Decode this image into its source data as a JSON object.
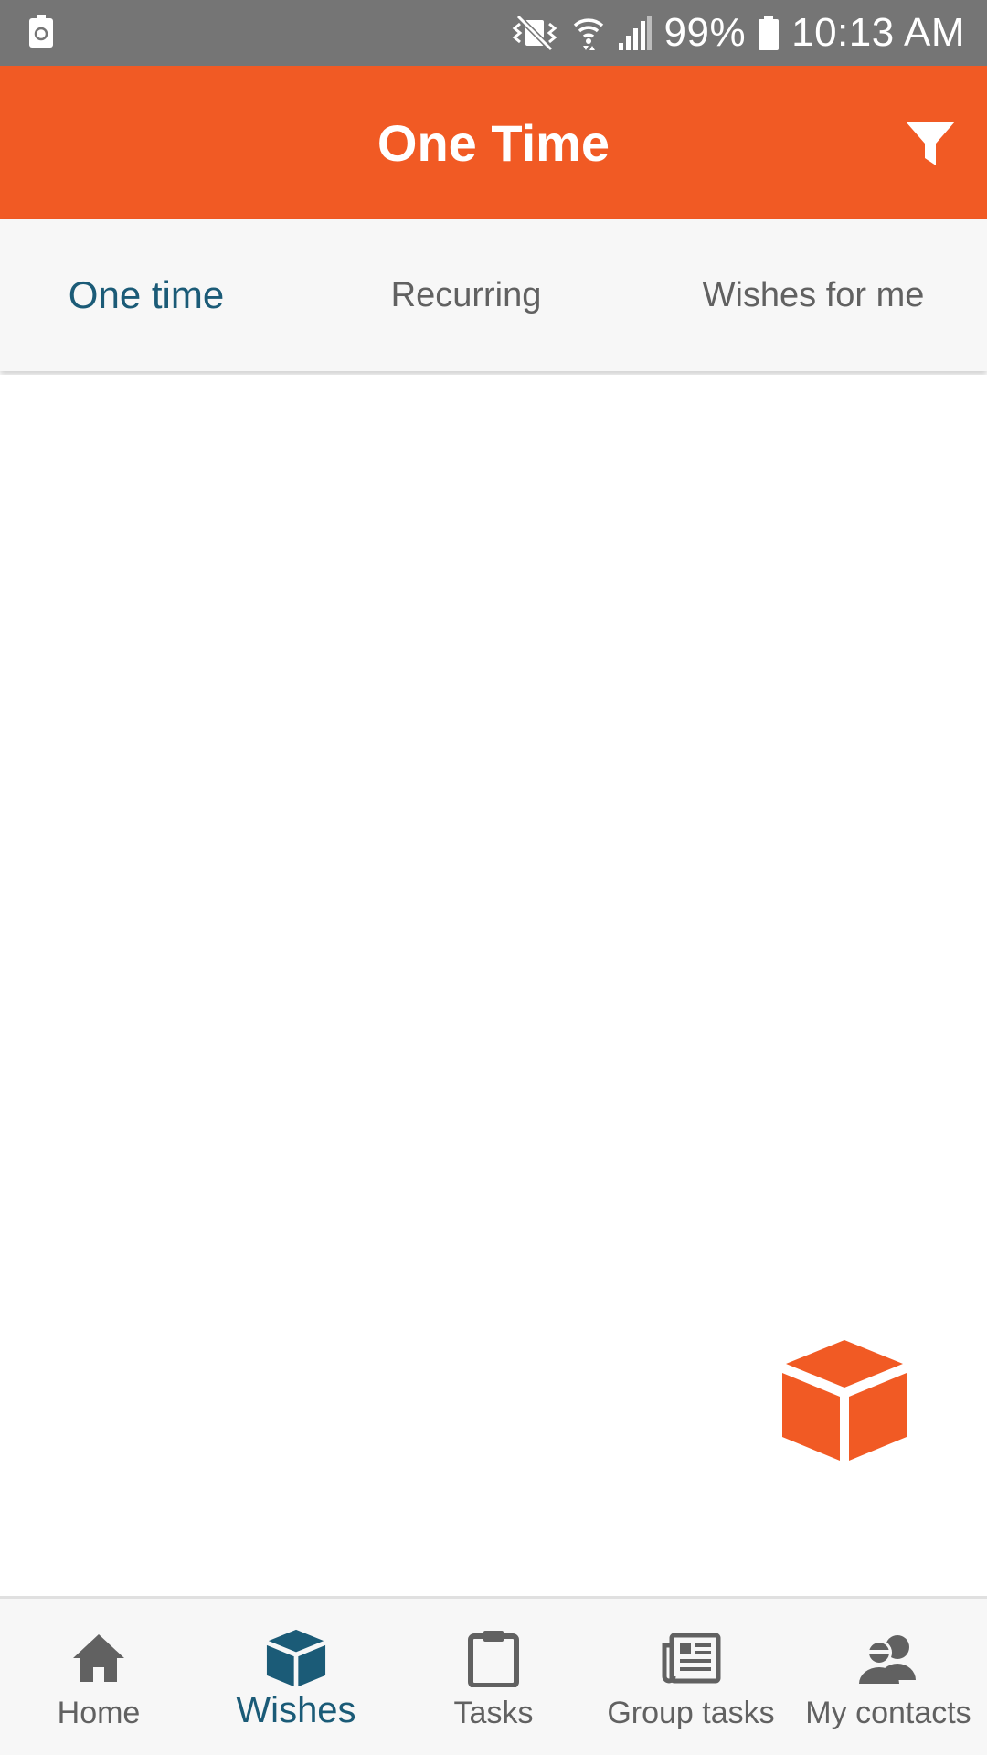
{
  "status_bar": {
    "battery_percent": "99%",
    "time": "10:13 AM"
  },
  "app_bar": {
    "title": "One Time"
  },
  "tabs": [
    {
      "label": "One time",
      "active": true
    },
    {
      "label": "Recurring",
      "active": false
    },
    {
      "label": "Wishes for me",
      "active": false
    }
  ],
  "bottom_nav": [
    {
      "label": "Home",
      "icon": "home-icon",
      "active": false
    },
    {
      "label": "Wishes",
      "icon": "cube-icon",
      "active": true
    },
    {
      "label": "Tasks",
      "icon": "clipboard-icon",
      "active": false
    },
    {
      "label": "Group tasks",
      "icon": "newspaper-icon",
      "active": false
    },
    {
      "label": "My contacts",
      "icon": "contacts-icon",
      "active": false
    }
  ],
  "colors": {
    "accent": "#F15A24",
    "primary": "#1B5B77",
    "inactive": "#616161",
    "status_bar": "#757575"
  }
}
